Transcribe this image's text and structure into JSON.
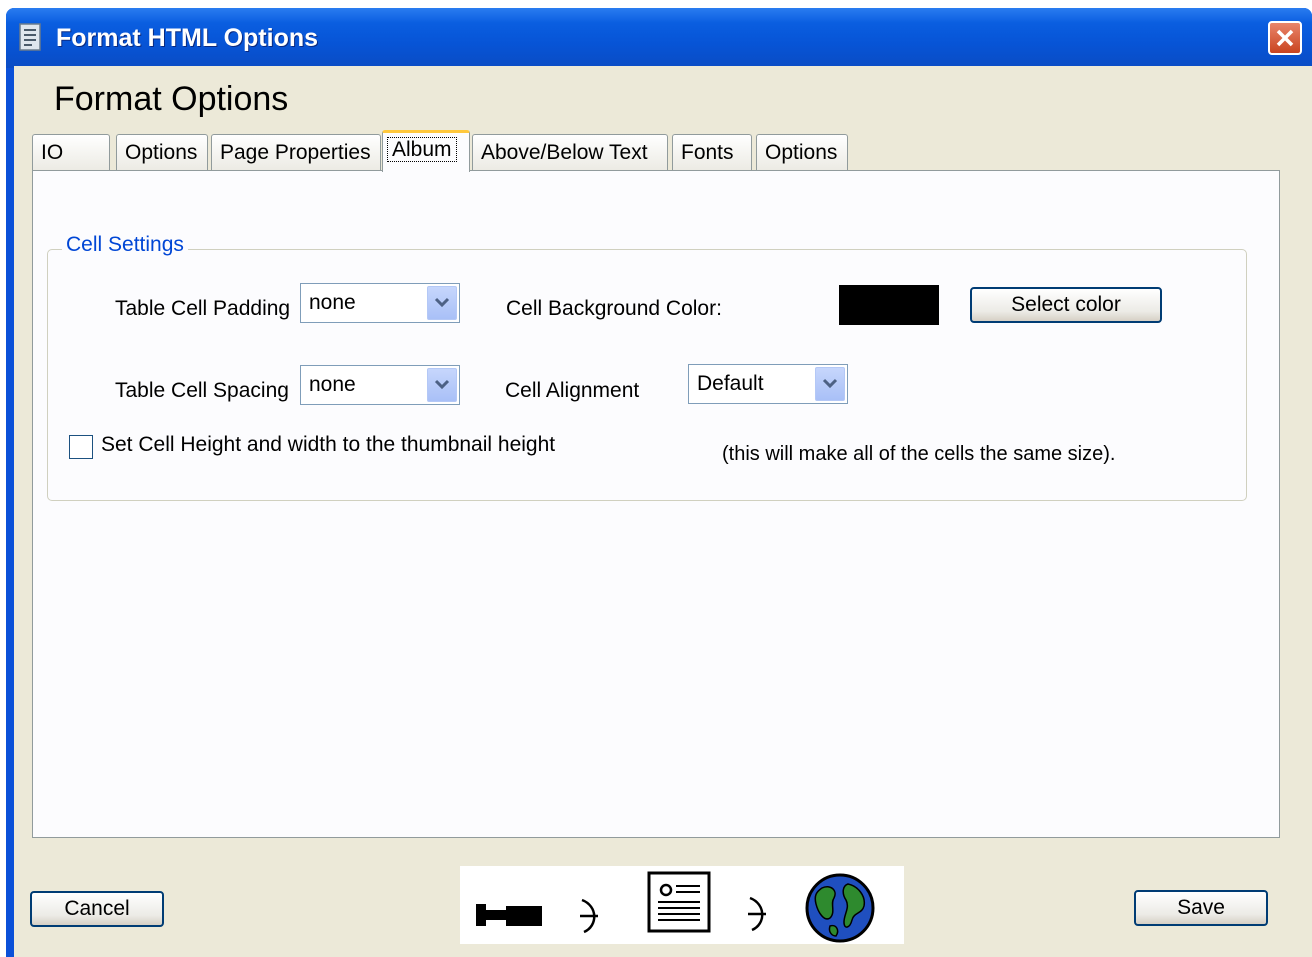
{
  "window": {
    "title": "Format HTML Options",
    "close_icon": "close-icon"
  },
  "page_title": "Format Options",
  "tabs": [
    {
      "label": "IO",
      "active": false
    },
    {
      "label": "Options",
      "active": false
    },
    {
      "label": "Page Properties",
      "active": false
    },
    {
      "label": "Album",
      "active": true
    },
    {
      "label": "Above/Below Text",
      "active": false
    },
    {
      "label": "Fonts",
      "active": false
    },
    {
      "label": "Options",
      "active": false
    }
  ],
  "cell_settings": {
    "legend": "Cell Settings",
    "padding_label": "Table Cell Padding",
    "padding_value": "none",
    "spacing_label": "Table Cell Spacing",
    "spacing_value": "none",
    "bg_color_label": "Cell Background Color:",
    "bg_color": "#000000",
    "select_color_label": "Select color",
    "alignment_label": "Cell Alignment",
    "alignment_value": "Default",
    "checkbox_label": "Set Cell Height and width to the thumbnail height",
    "checkbox_checked": false,
    "note": "(this will make all of the cells the same size)."
  },
  "footer": {
    "cancel_label": "Cancel",
    "save_label": "Save",
    "icons": [
      "camera-icon",
      "arrow-icon",
      "document-icon",
      "arrow-icon",
      "globe-icon"
    ]
  },
  "colors": {
    "titlebar": "#0a5ee0",
    "client_bg": "#ece9d8",
    "legend_text": "#0046d5",
    "active_tab_accent": "#ffc83c"
  }
}
